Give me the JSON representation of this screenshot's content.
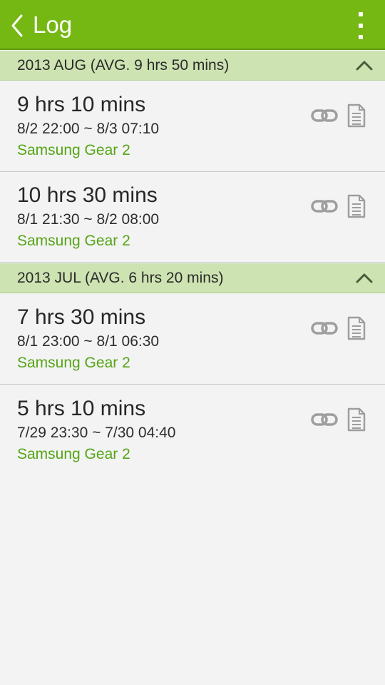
{
  "app_bar": {
    "title": "Log",
    "back_icon": "chevron-left-icon",
    "menu_icon": "overflow-menu-icon",
    "background_color": "#76b813"
  },
  "sections": [
    {
      "header": "2013 AUG (AVG. 9 hrs 50 mins)",
      "entries": [
        {
          "duration": "9 hrs 10 mins",
          "range": "8/2 22:00 ~ 8/3 07:10",
          "device": "Samsung Gear 2"
        },
        {
          "duration": "10 hrs 30 mins",
          "range": "8/1 21:30 ~ 8/2 08:00",
          "device": "Samsung Gear 2"
        }
      ]
    },
    {
      "header": "2013 JUL (AVG. 6 hrs 20 mins)",
      "entries": [
        {
          "duration": "7 hrs 30 mins",
          "range": "8/1 23:00 ~ 8/1 06:30",
          "device": "Samsung Gear 2"
        },
        {
          "duration": "5 hrs 10 mins",
          "range": "7/29 23:30 ~ 7/30 04:40",
          "device": "Samsung Gear 2"
        }
      ]
    }
  ],
  "icons": {
    "section_toggle": "chevron-up-icon",
    "entry_link": "link-icon",
    "entry_detail": "document-icon"
  },
  "colors": {
    "section_background": "#cde3b2",
    "device_text": "#55a516",
    "icon_gray": "#9e9e9e"
  }
}
